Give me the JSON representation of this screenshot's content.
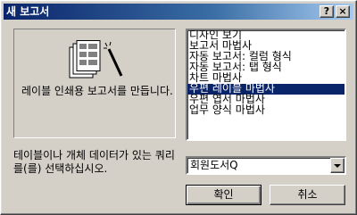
{
  "window": {
    "title": "새 보고서",
    "help_glyph": "?",
    "close_glyph": "×"
  },
  "description": {
    "text": "레이블 인쇄용 보고서를 만듭니다."
  },
  "report_types": {
    "items": [
      "디자인 보기",
      "보고서 마법사",
      "자동 보고서: 컬럼 형식",
      "자동 보고서: 탭 형식",
      "차트 마법사",
      "우편 레이블 마법사",
      "우편 엽서 마법사",
      "업무 양식 마법사"
    ],
    "selected_index": 5
  },
  "data_source": {
    "label": "테이블이나 개체 데이터가 있는 쿼리를(를) 선택하십시오.",
    "value": "회원도서Q"
  },
  "buttons": {
    "ok": "확인",
    "cancel": "취소"
  }
}
